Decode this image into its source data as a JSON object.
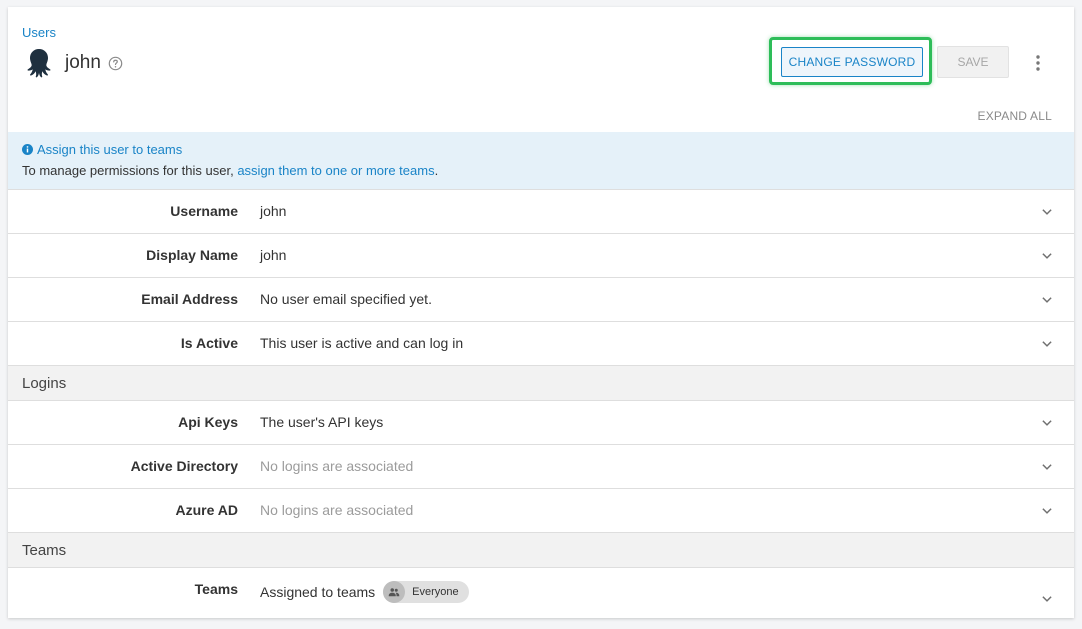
{
  "header": {
    "breadcrumb": "Users",
    "title": "john",
    "change_password_label": "CHANGE PASSWORD",
    "save_label": "SAVE",
    "expand_all_label": "EXPAND ALL"
  },
  "info": {
    "title": "Assign this user to teams",
    "text_before": "To manage permissions for this user, ",
    "link": "assign them to one or more teams",
    "text_after": "."
  },
  "fields": [
    {
      "label": "Username",
      "value": "john"
    },
    {
      "label": "Display Name",
      "value": "john"
    },
    {
      "label": "Email Address",
      "value": "No user email specified yet."
    },
    {
      "label": "Is Active",
      "value": "This user is active and can log in"
    }
  ],
  "logins": {
    "section_title": "Logins",
    "items": [
      {
        "label": "Api Keys",
        "value": "The user's API keys"
      },
      {
        "label": "Active Directory",
        "value": "No logins are associated"
      },
      {
        "label": "Azure AD",
        "value": "No logins are associated"
      }
    ]
  },
  "teams": {
    "section_title": "Teams",
    "label": "Teams",
    "value": "Assigned to teams",
    "chip": "Everyone"
  },
  "colors": {
    "accent": "#1a84c7",
    "highlight": "#2ebd59",
    "banner": "#e5f1f9"
  },
  "icons": [
    "octopus-avatar-icon",
    "help-circle-icon",
    "more-vert-icon",
    "info-icon",
    "chevron-down-icon",
    "people-icon"
  ]
}
